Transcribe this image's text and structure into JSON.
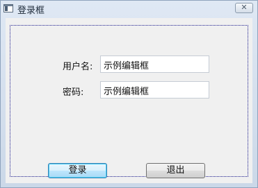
{
  "window": {
    "title": "登录框"
  },
  "titlebar": {
    "close_glyph": "✕",
    "icon": "app-window-icon"
  },
  "form": {
    "username_label": "用户名:",
    "username_value": "示例编辑框",
    "password_label": "密码:",
    "password_value": "示例编辑框"
  },
  "buttons": {
    "login_label": "登录",
    "exit_label": "退出"
  },
  "colors": {
    "client_background": "#f0f0f0",
    "default_button_border": "#3c7fb1",
    "focus_frame": "#1a1a8c"
  }
}
